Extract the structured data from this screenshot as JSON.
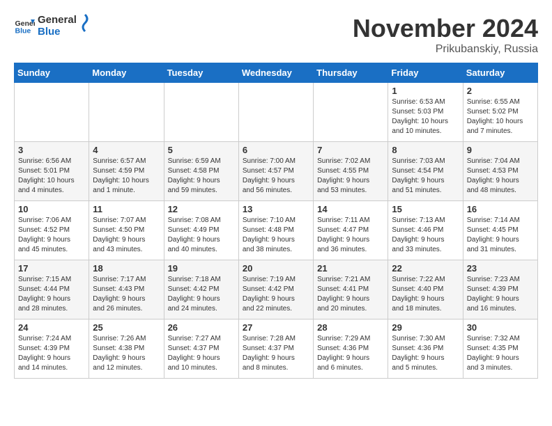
{
  "header": {
    "logo_line1": "General",
    "logo_line2": "Blue",
    "month": "November 2024",
    "location": "Prikubanskiy, Russia"
  },
  "weekdays": [
    "Sunday",
    "Monday",
    "Tuesday",
    "Wednesday",
    "Thursday",
    "Friday",
    "Saturday"
  ],
  "weeks": [
    [
      {
        "day": "",
        "info": ""
      },
      {
        "day": "",
        "info": ""
      },
      {
        "day": "",
        "info": ""
      },
      {
        "day": "",
        "info": ""
      },
      {
        "day": "",
        "info": ""
      },
      {
        "day": "1",
        "info": "Sunrise: 6:53 AM\nSunset: 5:03 PM\nDaylight: 10 hours\nand 10 minutes."
      },
      {
        "day": "2",
        "info": "Sunrise: 6:55 AM\nSunset: 5:02 PM\nDaylight: 10 hours\nand 7 minutes."
      }
    ],
    [
      {
        "day": "3",
        "info": "Sunrise: 6:56 AM\nSunset: 5:01 PM\nDaylight: 10 hours\nand 4 minutes."
      },
      {
        "day": "4",
        "info": "Sunrise: 6:57 AM\nSunset: 4:59 PM\nDaylight: 10 hours\nand 1 minute."
      },
      {
        "day": "5",
        "info": "Sunrise: 6:59 AM\nSunset: 4:58 PM\nDaylight: 9 hours\nand 59 minutes."
      },
      {
        "day": "6",
        "info": "Sunrise: 7:00 AM\nSunset: 4:57 PM\nDaylight: 9 hours\nand 56 minutes."
      },
      {
        "day": "7",
        "info": "Sunrise: 7:02 AM\nSunset: 4:55 PM\nDaylight: 9 hours\nand 53 minutes."
      },
      {
        "day": "8",
        "info": "Sunrise: 7:03 AM\nSunset: 4:54 PM\nDaylight: 9 hours\nand 51 minutes."
      },
      {
        "day": "9",
        "info": "Sunrise: 7:04 AM\nSunset: 4:53 PM\nDaylight: 9 hours\nand 48 minutes."
      }
    ],
    [
      {
        "day": "10",
        "info": "Sunrise: 7:06 AM\nSunset: 4:52 PM\nDaylight: 9 hours\nand 45 minutes."
      },
      {
        "day": "11",
        "info": "Sunrise: 7:07 AM\nSunset: 4:50 PM\nDaylight: 9 hours\nand 43 minutes."
      },
      {
        "day": "12",
        "info": "Sunrise: 7:08 AM\nSunset: 4:49 PM\nDaylight: 9 hours\nand 40 minutes."
      },
      {
        "day": "13",
        "info": "Sunrise: 7:10 AM\nSunset: 4:48 PM\nDaylight: 9 hours\nand 38 minutes."
      },
      {
        "day": "14",
        "info": "Sunrise: 7:11 AM\nSunset: 4:47 PM\nDaylight: 9 hours\nand 36 minutes."
      },
      {
        "day": "15",
        "info": "Sunrise: 7:13 AM\nSunset: 4:46 PM\nDaylight: 9 hours\nand 33 minutes."
      },
      {
        "day": "16",
        "info": "Sunrise: 7:14 AM\nSunset: 4:45 PM\nDaylight: 9 hours\nand 31 minutes."
      }
    ],
    [
      {
        "day": "17",
        "info": "Sunrise: 7:15 AM\nSunset: 4:44 PM\nDaylight: 9 hours\nand 28 minutes."
      },
      {
        "day": "18",
        "info": "Sunrise: 7:17 AM\nSunset: 4:43 PM\nDaylight: 9 hours\nand 26 minutes."
      },
      {
        "day": "19",
        "info": "Sunrise: 7:18 AM\nSunset: 4:42 PM\nDaylight: 9 hours\nand 24 minutes."
      },
      {
        "day": "20",
        "info": "Sunrise: 7:19 AM\nSunset: 4:42 PM\nDaylight: 9 hours\nand 22 minutes."
      },
      {
        "day": "21",
        "info": "Sunrise: 7:21 AM\nSunset: 4:41 PM\nDaylight: 9 hours\nand 20 minutes."
      },
      {
        "day": "22",
        "info": "Sunrise: 7:22 AM\nSunset: 4:40 PM\nDaylight: 9 hours\nand 18 minutes."
      },
      {
        "day": "23",
        "info": "Sunrise: 7:23 AM\nSunset: 4:39 PM\nDaylight: 9 hours\nand 16 minutes."
      }
    ],
    [
      {
        "day": "24",
        "info": "Sunrise: 7:24 AM\nSunset: 4:39 PM\nDaylight: 9 hours\nand 14 minutes."
      },
      {
        "day": "25",
        "info": "Sunrise: 7:26 AM\nSunset: 4:38 PM\nDaylight: 9 hours\nand 12 minutes."
      },
      {
        "day": "26",
        "info": "Sunrise: 7:27 AM\nSunset: 4:37 PM\nDaylight: 9 hours\nand 10 minutes."
      },
      {
        "day": "27",
        "info": "Sunrise: 7:28 AM\nSunset: 4:37 PM\nDaylight: 9 hours\nand 8 minutes."
      },
      {
        "day": "28",
        "info": "Sunrise: 7:29 AM\nSunset: 4:36 PM\nDaylight: 9 hours\nand 6 minutes."
      },
      {
        "day": "29",
        "info": "Sunrise: 7:30 AM\nSunset: 4:36 PM\nDaylight: 9 hours\nand 5 minutes."
      },
      {
        "day": "30",
        "info": "Sunrise: 7:32 AM\nSunset: 4:35 PM\nDaylight: 9 hours\nand 3 minutes."
      }
    ]
  ]
}
